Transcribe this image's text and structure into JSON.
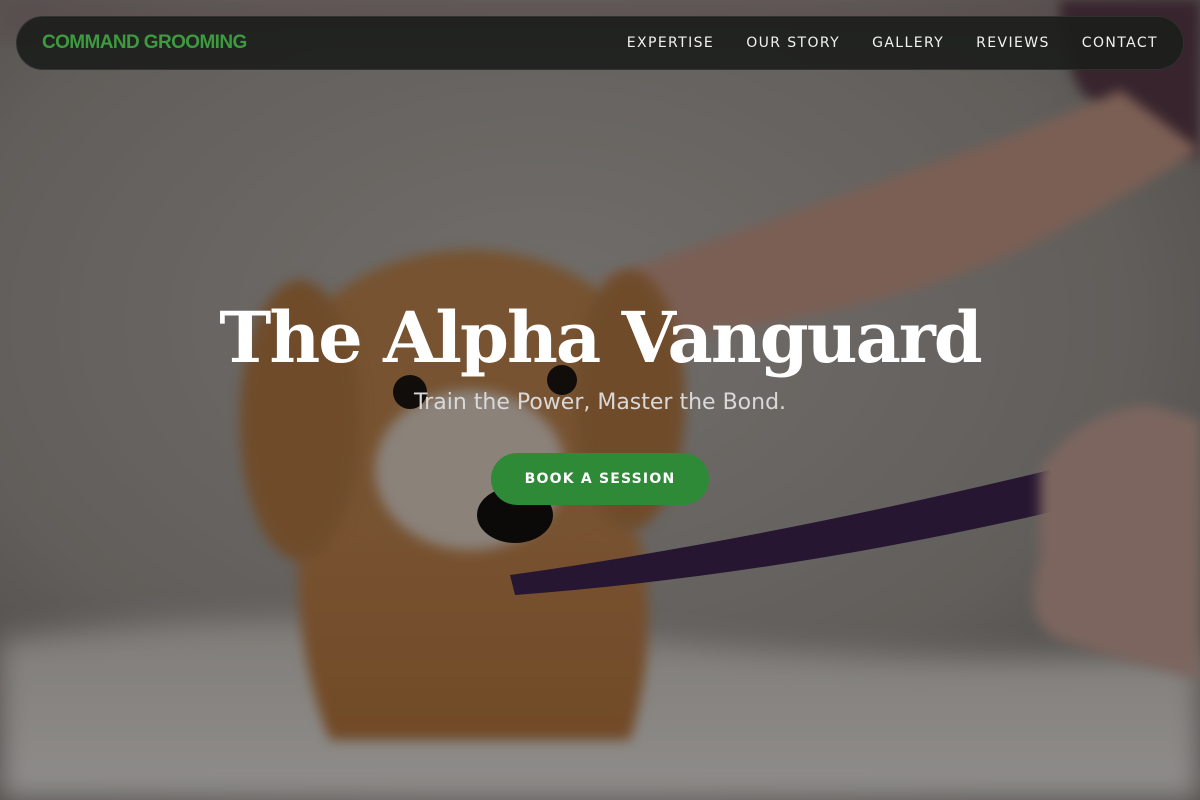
{
  "brand": {
    "name": "COMMAND GROOMING",
    "color": "#3d9a3f"
  },
  "nav": {
    "items": [
      {
        "label": "EXPERTISE"
      },
      {
        "label": "OUR STORY"
      },
      {
        "label": "GALLERY"
      },
      {
        "label": "REVIEWS"
      },
      {
        "label": "CONTACT"
      }
    ]
  },
  "hero": {
    "title": "The Alpha Vanguard",
    "subtitle": "Train the Power, Master the Bond.",
    "cta_label": "BOOK A SESSION",
    "cta_color": "#2f8a38",
    "background_image": "wet-dog-on-leash-photo"
  }
}
